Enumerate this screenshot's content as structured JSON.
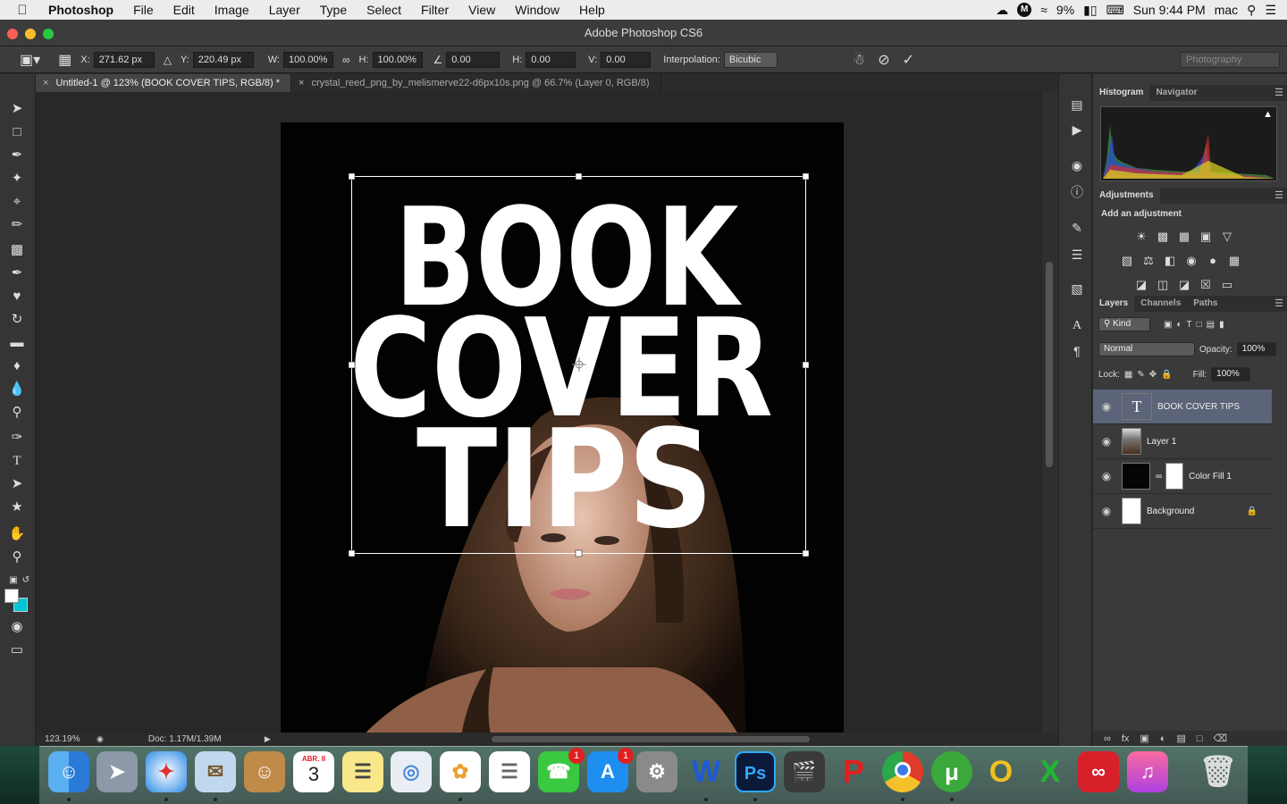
{
  "menubar": {
    "app_name": "Photoshop",
    "items": [
      "File",
      "Edit",
      "Image",
      "Layer",
      "Type",
      "Select",
      "Filter",
      "View",
      "Window",
      "Help"
    ],
    "battery": "9%",
    "clock": "Sun 9:44 PM",
    "user": "mac"
  },
  "window_title": "Adobe Photoshop CS6",
  "options": {
    "x_label": "X:",
    "x_value": "271.62 px",
    "y_label": "Y:",
    "y_value": "220.49 px",
    "w_label": "W:",
    "w_value": "100.00%",
    "h_label": "H:",
    "h_value": "100.00%",
    "angle_value": "0.00",
    "hskew_label": "H:",
    "hskew_value": "0.00",
    "vskew_label": "V:",
    "vskew_value": "0.00",
    "interp_label": "Interpolation:",
    "interp_value": "Bicubic",
    "workspace": "Photography"
  },
  "tabs": [
    {
      "label": "Untitled-1 @ 123% (BOOK COVER TIPS, RGB/8) *",
      "active": true
    },
    {
      "label": "crystal_reed_png_by_melismerve22-d6px10s.png @ 66.7% (Layer 0, RGB/8)",
      "active": false
    }
  ],
  "canvas": {
    "line1": "BOOK",
    "line2": "COVER",
    "line3": "TIPS"
  },
  "status": {
    "zoom": "123.19%",
    "doc": "Doc: 1.17M/1.39M"
  },
  "panels": {
    "histogram_tab": "Histogram",
    "navigator_tab": "Navigator",
    "adjustments_tab": "Adjustments",
    "add_adjustment": "Add an adjustment",
    "layers_tab": "Layers",
    "channels_tab": "Channels",
    "paths_tab": "Paths",
    "kind": "Kind",
    "blend_mode": "Normal",
    "opacity_label": "Opacity:",
    "opacity_value": "100%",
    "lock_label": "Lock:",
    "fill_label": "Fill:",
    "fill_value": "100%"
  },
  "layers": [
    {
      "name": "BOOK COVER TIPS",
      "type": "text",
      "selected": true
    },
    {
      "name": "Layer 1",
      "type": "image",
      "selected": false
    },
    {
      "name": "Color Fill 1",
      "type": "fill",
      "selected": false
    },
    {
      "name": "Background",
      "type": "background",
      "selected": false
    }
  ],
  "dock": {
    "calendar_month": "ABR. II",
    "calendar_day": "3",
    "facetime_badge": "1",
    "appstore_badge": "1",
    "word_label": "W",
    "ps_label": "Ps"
  },
  "colors": {
    "selected_layer": "#5b6478",
    "canvas_bg": "#020202",
    "foreground": "#ffffff",
    "background_swatch": "#00c6d8"
  }
}
